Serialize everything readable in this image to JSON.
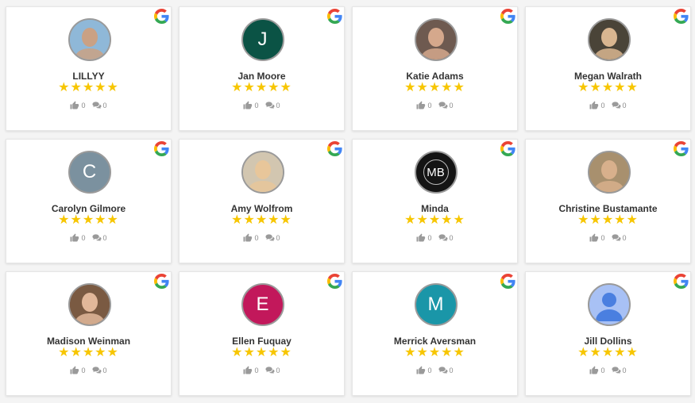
{
  "colors": {
    "star": "#f7c600",
    "avatar_border": "#9a9a9a"
  },
  "reviews": [
    {
      "name": "LILLYY",
      "stars": "★★★★★",
      "likes": "0",
      "comments": "0",
      "avatar": {
        "type": "photo",
        "icon": "face-photo",
        "bg": "#8fb8d8",
        "fg": "#caa184"
      }
    },
    {
      "name": "Jan Moore",
      "stars": "★★★★★",
      "likes": "0",
      "comments": "0",
      "avatar": {
        "type": "letter",
        "letter": "J",
        "bg": "#0b5345"
      }
    },
    {
      "name": "Katie Adams",
      "stars": "★★★★★",
      "likes": "0",
      "comments": "0",
      "avatar": {
        "type": "photo",
        "icon": "face-photo",
        "bg": "#6e5a50",
        "fg": "#d5a88c"
      }
    },
    {
      "name": "Megan Walrath",
      "stars": "★★★★★",
      "likes": "0",
      "comments": "0",
      "avatar": {
        "type": "photo",
        "icon": "face-photo",
        "bg": "#4a4438",
        "fg": "#d9b690"
      }
    },
    {
      "name": "Carolyn Gilmore",
      "stars": "★★★★★",
      "likes": "0",
      "comments": "0",
      "avatar": {
        "type": "letter",
        "letter": "C",
        "bg": "#7b919f"
      }
    },
    {
      "name": "Amy Wolfrom",
      "stars": "★★★★★",
      "likes": "0",
      "comments": "0",
      "avatar": {
        "type": "photo",
        "icon": "face-photo",
        "bg": "#d2c6b0",
        "fg": "#e8c69a"
      }
    },
    {
      "name": "Minda",
      "stars": "★★★★★",
      "likes": "0",
      "comments": "0",
      "avatar": {
        "type": "letter",
        "letter": "MB",
        "bg": "#141414"
      }
    },
    {
      "name": "Christine Bustamante",
      "stars": "★★★★★",
      "likes": "0",
      "comments": "0",
      "avatar": {
        "type": "photo",
        "icon": "face-photo",
        "bg": "#a8906e",
        "fg": "#d8b08c"
      }
    },
    {
      "name": "Madison Weinman",
      "stars": "★★★★★",
      "likes": "0",
      "comments": "0",
      "avatar": {
        "type": "photo",
        "icon": "face-photo",
        "bg": "#7a5a42",
        "fg": "#e2b89a"
      }
    },
    {
      "name": "Ellen Fuquay",
      "stars": "★★★★★",
      "likes": "0",
      "comments": "0",
      "avatar": {
        "type": "letter",
        "letter": "E",
        "bg": "#c2185b"
      }
    },
    {
      "name": "Merrick Aversman",
      "stars": "★★★★★",
      "likes": "0",
      "comments": "0",
      "avatar": {
        "type": "letter",
        "letter": "M",
        "bg": "#1a96a8"
      }
    },
    {
      "name": "Jill Dollins",
      "stars": "★★★★★",
      "likes": "0",
      "comments": "0",
      "avatar": {
        "type": "silhouette",
        "icon": "default-user-icon",
        "bg": "#a8c1f5",
        "fg": "#4a7fe0"
      }
    }
  ]
}
